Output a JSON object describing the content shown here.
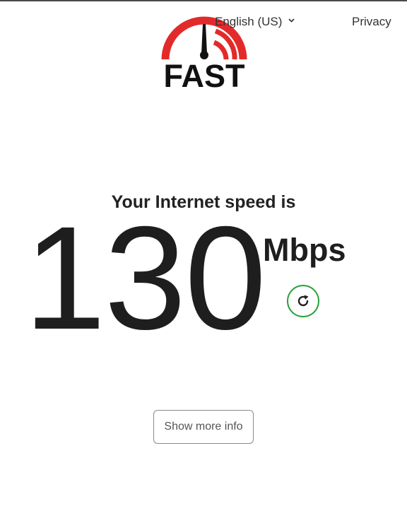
{
  "header": {
    "logo_text": "FAST",
    "language": "English (US)",
    "privacy": "Privacy"
  },
  "main": {
    "caption": "Your Internet speed is",
    "speed_value": "130",
    "speed_units": "Mbps",
    "refresh_icon": "refresh-icon",
    "show_more_label": "Show more info"
  },
  "icons": {
    "language_chevron": "chevron-down-icon",
    "logo_gauge": "speedometer-icon"
  },
  "colors": {
    "logo_red": "#e32a2a",
    "refresh_green": "#29a33b",
    "text_dark": "#1e1e1e"
  }
}
